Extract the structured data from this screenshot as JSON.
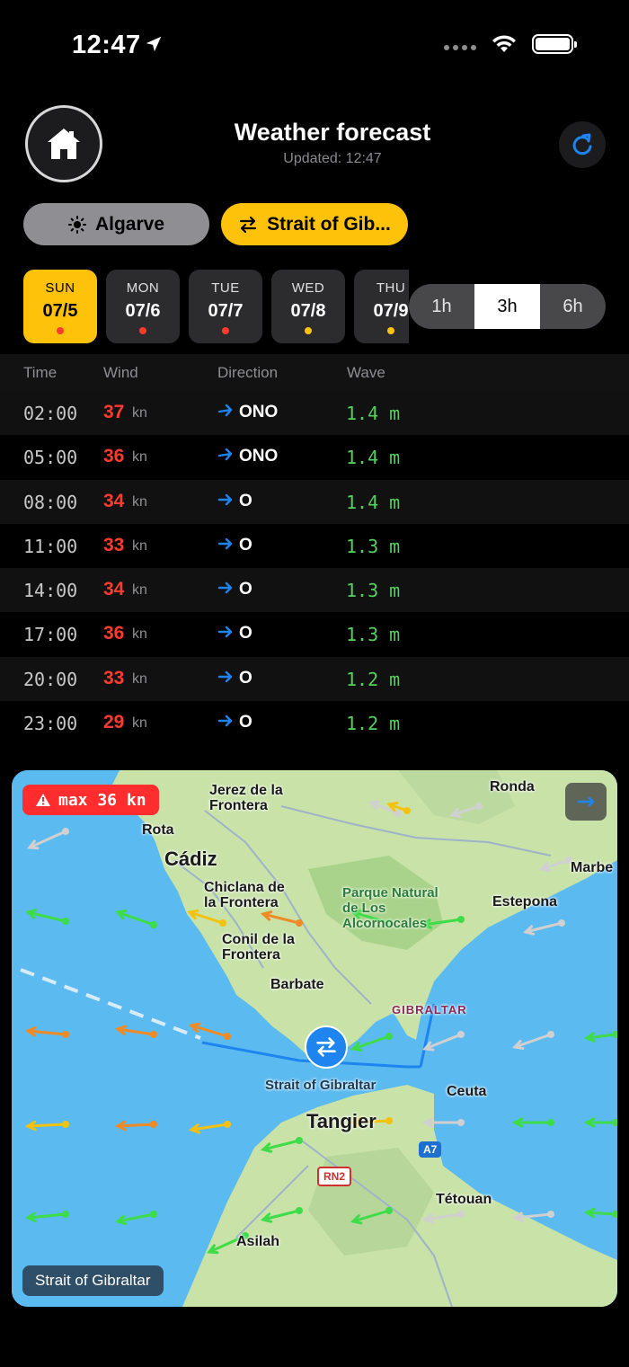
{
  "status_bar": {
    "time": "12:47"
  },
  "header": {
    "title": "Weather forecast",
    "updated": "Updated: 12:47"
  },
  "locations": [
    {
      "label": "Algarve",
      "icon": "sun-icon",
      "selected": false
    },
    {
      "label": "Strait of Gib...",
      "icon": "swap-arrows-icon",
      "selected": true
    }
  ],
  "days": [
    {
      "name": "SUN",
      "date": "07/5",
      "dot": "#ff3b30",
      "active": true
    },
    {
      "name": "MON",
      "date": "07/6",
      "dot": "#ff3b30",
      "active": false
    },
    {
      "name": "TUE",
      "date": "07/7",
      "dot": "#ff3b30",
      "active": false
    },
    {
      "name": "WED",
      "date": "07/8",
      "dot": "#ffc20a",
      "active": false
    },
    {
      "name": "THU",
      "date": "07/9",
      "dot": "#ffc20a",
      "active": false
    }
  ],
  "interval": {
    "options": [
      "1h",
      "3h",
      "6h"
    ],
    "selected": "3h"
  },
  "table": {
    "headers": {
      "time": "Time",
      "wind": "Wind",
      "direction": "Direction",
      "wave": "Wave"
    },
    "unit": "kn",
    "rows": [
      {
        "time": "02:00",
        "wind": "37",
        "direction": "ONO",
        "wave": "1.4 m"
      },
      {
        "time": "05:00",
        "wind": "36",
        "direction": "ONO",
        "wave": "1.4 m"
      },
      {
        "time": "08:00",
        "wind": "34",
        "direction": "O",
        "wave": "1.4 m"
      },
      {
        "time": "11:00",
        "wind": "33",
        "direction": "O",
        "wave": "1.3 m"
      },
      {
        "time": "14:00",
        "wind": "34",
        "direction": "O",
        "wave": "1.3 m"
      },
      {
        "time": "17:00",
        "wind": "36",
        "direction": "O",
        "wave": "1.3 m"
      },
      {
        "time": "20:00",
        "wind": "33",
        "direction": "O",
        "wave": "1.2 m"
      },
      {
        "time": "23:00",
        "wind": "29",
        "direction": "O",
        "wave": "1.2 m"
      }
    ]
  },
  "map": {
    "max_badge": "max 36 kn",
    "caption": "Strait of Gibraltar",
    "labels": {
      "jerez": "Jerez de la\nFrontera",
      "ronda": "Ronda",
      "rota": "Rota",
      "cadiz": "Cádiz",
      "marbella": "Marbe",
      "chiclana": "Chiclana de\nla Frontera",
      "park": "Parque Natural\nde Los\nAlcornocales",
      "estepona": "Estepona",
      "conil": "Conil de la\nFrontera",
      "barbate": "Barbate",
      "gibraltar": "GIBRALTAR",
      "strait": "Strait of Gibraltar",
      "ceuta": "Ceuta",
      "tangier": "Tangier",
      "a7": "A7",
      "rn2": "RN2",
      "tetouan": "Tétouan",
      "asilah": "Asilah"
    },
    "colors": {
      "green": "#3ddc48",
      "orange": "#f08a24",
      "yellow": "#f4c20d",
      "grey": "#d0d0d0"
    }
  }
}
